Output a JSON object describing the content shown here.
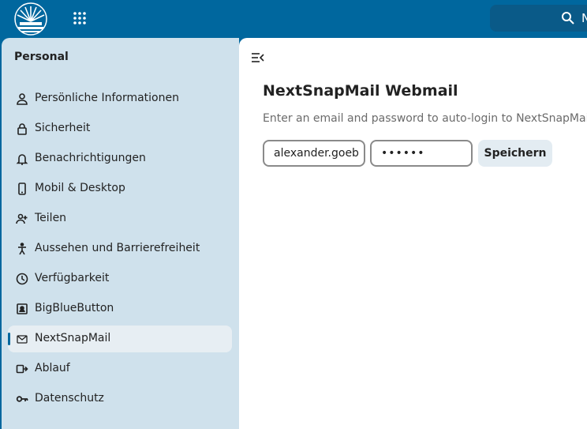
{
  "header": {
    "logo": "nextcloud-logo",
    "apps_icon": "apps-grid-icon",
    "search": {
      "icon": "search-icon",
      "visible_text": "N"
    }
  },
  "sidebar": {
    "title": "Personal",
    "items": [
      {
        "label": "Persönliche Informationen",
        "icon": "person-icon",
        "active": false
      },
      {
        "label": "Sicherheit",
        "icon": "lock-icon",
        "active": false
      },
      {
        "label": "Benachrichtigungen",
        "icon": "bell-icon",
        "active": false
      },
      {
        "label": "Mobil & Desktop",
        "icon": "phone-icon",
        "active": false
      },
      {
        "label": "Teilen",
        "icon": "share-user-icon",
        "active": false
      },
      {
        "label": "Aussehen und Barrierefreiheit",
        "icon": "accessibility-icon",
        "active": false
      },
      {
        "label": "Verfügbarkeit",
        "icon": "clock-icon",
        "active": false
      },
      {
        "label": "BigBlueButton",
        "icon": "bigbluebutton-icon",
        "active": false
      },
      {
        "label": "NextSnapMail",
        "icon": "mail-icon",
        "active": true
      },
      {
        "label": "Ablauf",
        "icon": "flow-icon",
        "active": false
      },
      {
        "label": "Datenschutz",
        "icon": "key-icon",
        "active": false
      }
    ]
  },
  "main": {
    "title": "NextSnapMail Webmail",
    "description": "Enter an email and password to auto-login to NextSnapMail.",
    "email_value": "alexander.goeb",
    "password_value": "••••••",
    "save_label": "Speichern"
  },
  "colors": {
    "header_bg": "#00679e",
    "sidebar_bg": "#cfe1ec",
    "active_item_bg": "#e7eef3",
    "button_bg": "#e3ecf2"
  }
}
